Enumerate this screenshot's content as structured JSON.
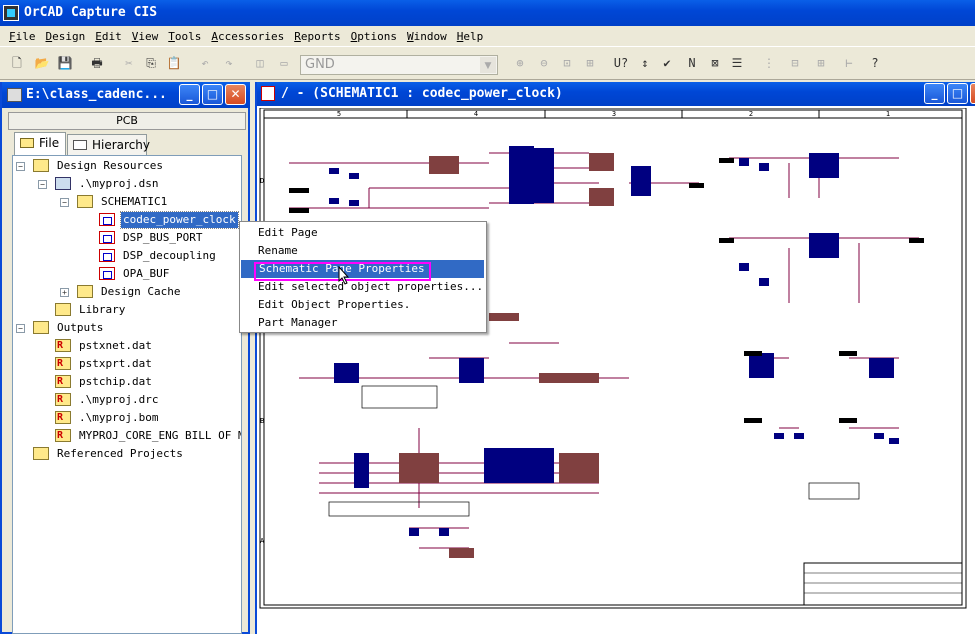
{
  "app": {
    "title": "OrCAD Capture CIS"
  },
  "menu": [
    "File",
    "Design",
    "Edit",
    "View",
    "Tools",
    "Accessories",
    "Reports",
    "Options",
    "Window",
    "Help"
  ],
  "toolbar": {
    "net_combo_value": "GND",
    "icons": [
      "new-icon",
      "open-icon",
      "save-icon",
      "print-icon",
      "cut-icon",
      "copy-icon",
      "paste-icon",
      "undo-icon",
      "redo-icon",
      "tile-icon",
      "cascade-icon",
      "zoom-in-icon",
      "zoom-out-icon",
      "zoom-area-icon",
      "zoom-all-icon",
      "annotate-icon",
      "back-annotate-icon",
      "drc-icon",
      "netlist-icon",
      "cross-ref-icon",
      "bom-icon",
      "snap-icon",
      "hier-icon",
      "hier2-icon",
      "project-manager-icon",
      "help-icon"
    ]
  },
  "project_window": {
    "title": "E:\\class_cadenc...",
    "header": "PCB",
    "tabs": [
      "File",
      "Hierarchy"
    ],
    "tree": [
      {
        "label": "Design Resources",
        "icon": "folder",
        "level": 0,
        "expander": "-"
      },
      {
        "label": ".\\myproj.dsn",
        "icon": "dsn",
        "level": 1,
        "expander": "-"
      },
      {
        "label": "SCHEMATIC1",
        "icon": "folder",
        "level": 2,
        "expander": "-"
      },
      {
        "label": "codec_power_clock",
        "icon": "page",
        "level": 3,
        "selected": true
      },
      {
        "label": "DSP_BUS_PORT",
        "icon": "page",
        "level": 3
      },
      {
        "label": "DSP_decoupling",
        "icon": "page",
        "level": 3
      },
      {
        "label": "OPA_BUF",
        "icon": "page",
        "level": 3
      },
      {
        "label": "Design Cache",
        "icon": "folder",
        "level": 2,
        "expander": "+"
      },
      {
        "label": "Library",
        "icon": "folder",
        "level": 1
      },
      {
        "label": "Outputs",
        "icon": "folder",
        "level": 0,
        "expander": "-"
      },
      {
        "label": "pstxnet.dat",
        "icon": "report",
        "level": 1
      },
      {
        "label": "pstxprt.dat",
        "icon": "report",
        "level": 1
      },
      {
        "label": "pstchip.dat",
        "icon": "report",
        "level": 1
      },
      {
        "label": ".\\myproj.drc",
        "icon": "report",
        "level": 1
      },
      {
        "label": ".\\myproj.bom",
        "icon": "report",
        "level": 1
      },
      {
        "label": "MYPROJ_CORE_ENG BILL OF MA",
        "icon": "report",
        "level": 1
      },
      {
        "label": "Referenced Projects",
        "icon": "folder",
        "level": 0
      }
    ]
  },
  "schematic_window": {
    "title": "/ - (SCHEMATIC1 : codec_power_clock)",
    "columns": [
      "5",
      "4",
      "3",
      "2",
      "1"
    ],
    "rows": [
      "D",
      "B",
      "A"
    ]
  },
  "context_menu": {
    "items": [
      "Edit Page",
      "Rename",
      "Schematic Page Properties",
      "Edit selected object properties...",
      "Edit Object Properties.",
      "Part Manager"
    ],
    "highlighted": "Schematic Page Properties"
  },
  "colors": {
    "titlebar": "#0047d6",
    "selection": "#316ac5",
    "highlight_box": "#ff00ff",
    "wire": "#800040",
    "part": "#000080",
    "part_body": "#804040"
  }
}
